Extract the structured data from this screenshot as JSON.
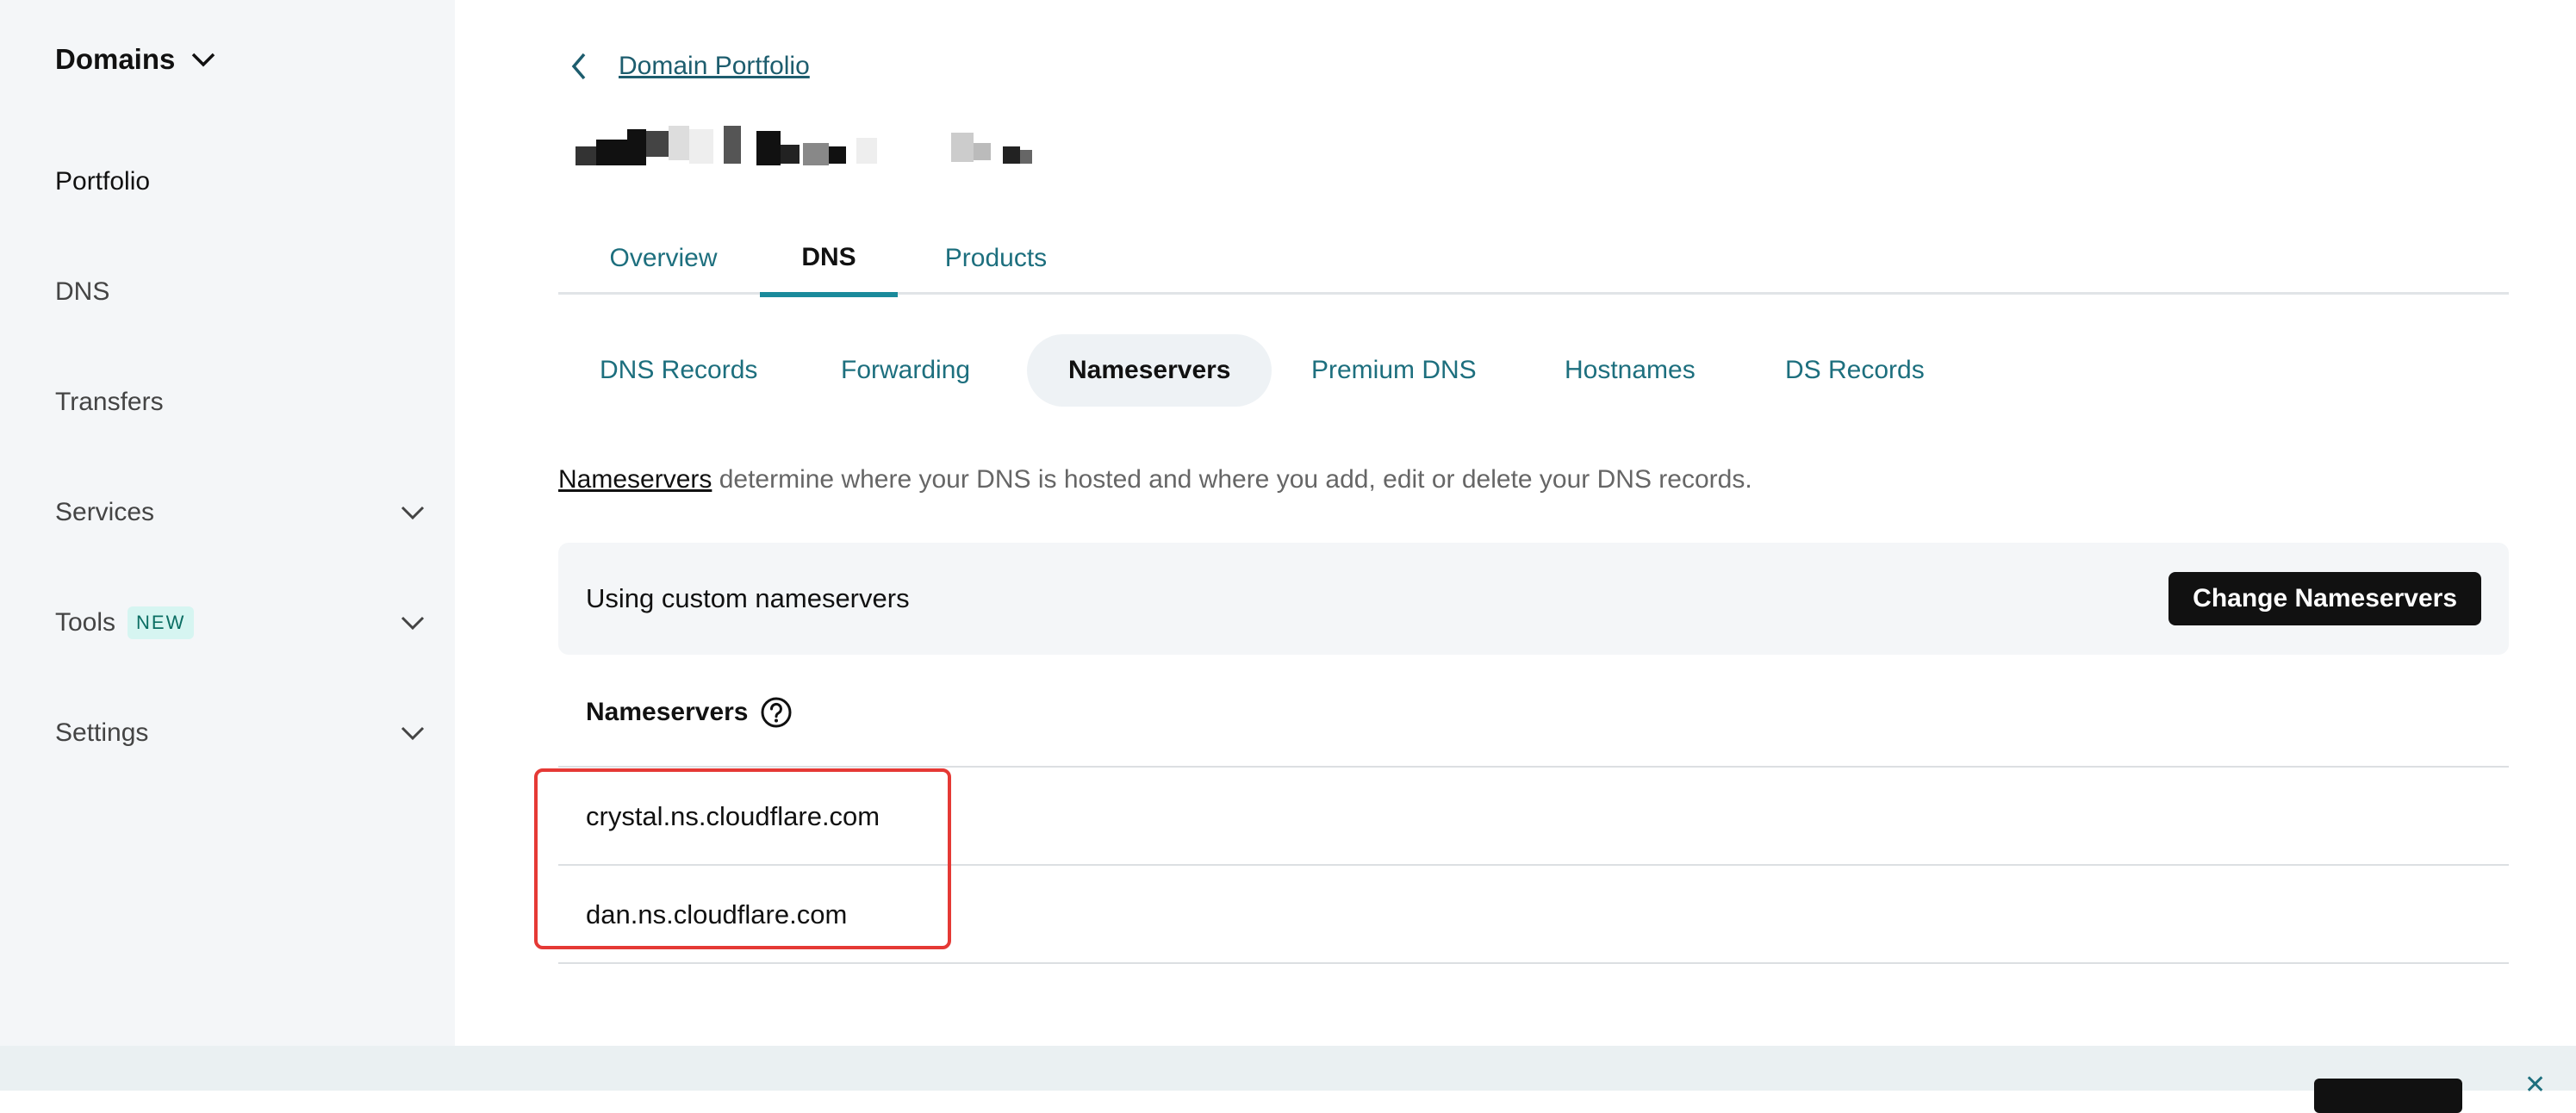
{
  "sidebar": {
    "title": "Domains",
    "items": [
      {
        "label": "Portfolio",
        "expandable": false,
        "active": true
      },
      {
        "label": "DNS",
        "expandable": false
      },
      {
        "label": "Transfers",
        "expandable": false
      },
      {
        "label": "Services",
        "expandable": true
      },
      {
        "label": "Tools",
        "badge": "NEW",
        "expandable": true
      },
      {
        "label": "Settings",
        "expandable": true
      }
    ]
  },
  "breadcrumb": {
    "back_label": "Domain Portfolio"
  },
  "tabs": [
    {
      "label": "Overview"
    },
    {
      "label": "DNS",
      "active": true
    },
    {
      "label": "Products"
    }
  ],
  "subtabs": [
    {
      "label": "DNS Records"
    },
    {
      "label": "Forwarding"
    },
    {
      "label": "Nameservers",
      "active": true
    },
    {
      "label": "Premium DNS"
    },
    {
      "label": "Hostnames"
    },
    {
      "label": "DS Records"
    }
  ],
  "description": {
    "link": "Nameservers",
    "text": " determine where your DNS is hosted and where you add, edit or delete your DNS records."
  },
  "status": {
    "text": "Using custom nameservers",
    "button": "Change Nameservers"
  },
  "nameservers": {
    "header": "Nameservers",
    "list": [
      "crystal.ns.cloudflare.com",
      "dan.ns.cloudflare.com"
    ]
  },
  "colors": {
    "accent": "#1d6f7e",
    "tab_underline": "#1a8a9b",
    "highlight": "#e53935",
    "sidebar_bg": "#f4f6f8"
  },
  "icons": {
    "back": "chevron-left-icon",
    "expand": "chevron-down-icon",
    "help": "question-circle-icon",
    "close": "close-icon"
  }
}
